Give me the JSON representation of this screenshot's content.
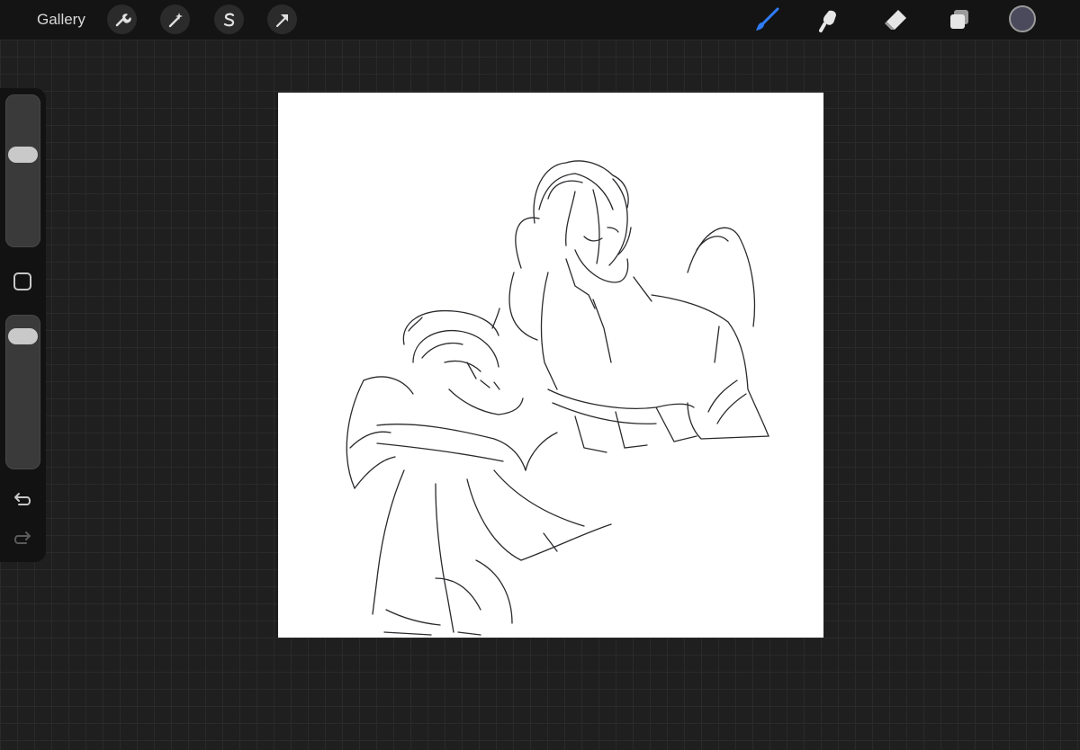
{
  "topbar": {
    "gallery_label": "Gallery",
    "left_tools": [
      {
        "icon": "wrench-icon",
        "name": "actions"
      },
      {
        "icon": "magic-wand-icon",
        "name": "adjustments"
      },
      {
        "icon": "selection-s-icon",
        "name": "selection"
      },
      {
        "icon": "arrow-cursor-icon",
        "name": "transform"
      }
    ],
    "right_tools": [
      {
        "icon": "brush-icon",
        "name": "paint",
        "active": true
      },
      {
        "icon": "smudge-icon",
        "name": "smudge"
      },
      {
        "icon": "eraser-icon",
        "name": "eraser"
      },
      {
        "icon": "layers-icon",
        "name": "layers"
      }
    ],
    "current_color": "#4a4a5c"
  },
  "sidebar": {
    "brush_size": 0.62,
    "brush_opacity": 0.92,
    "icons": [
      "modify-square-icon",
      "undo-icon",
      "redo-icon"
    ]
  },
  "colors": {
    "active_tool": "#2f7cf6",
    "toolbar_bg": "#141414",
    "canvas_bg": "#ffffff",
    "workspace_bg": "#1f1f1f"
  }
}
